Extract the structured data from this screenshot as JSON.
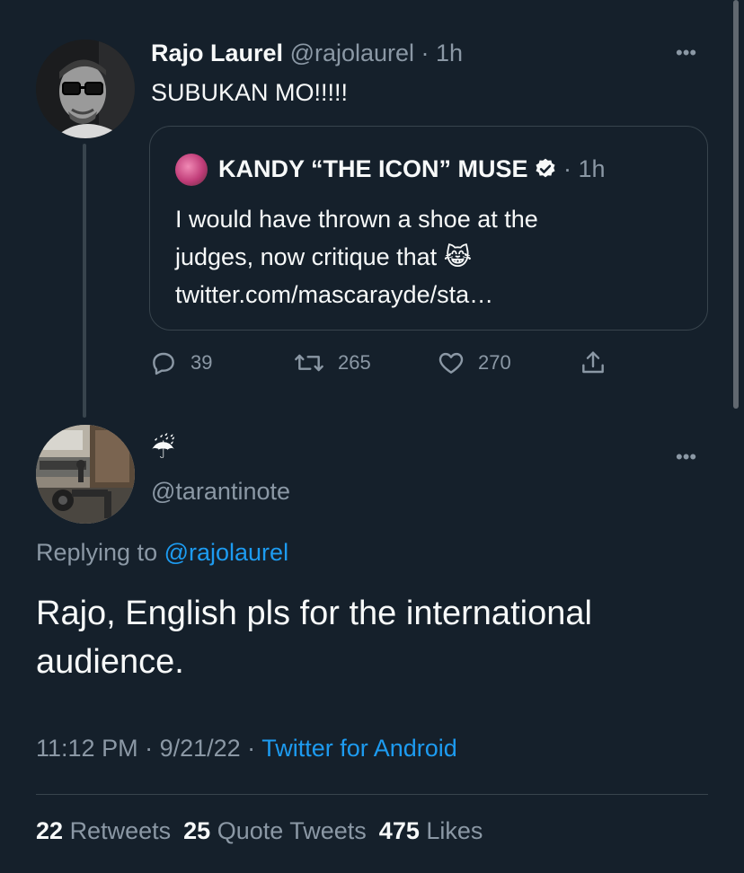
{
  "tweet_parent": {
    "display_name": "Rajo Laurel",
    "handle": "@rajolaurel",
    "separator": " · ",
    "time": "1h",
    "text": "SUBUKAN MO!!!!!",
    "more_label": "•••",
    "quoted": {
      "display_name": "KANDY “THE ICON” MUSE",
      "verified": true,
      "separator": " · ",
      "time": "1h",
      "lines": [
        "I would have thrown a shoe at the",
        "judges, now critique that 😹",
        "twitter.com/mascarayde/sta…"
      ]
    },
    "actions": {
      "replies": "39",
      "retweets": "265",
      "likes": "270"
    }
  },
  "tweet_main": {
    "display_name_emoji": "☔",
    "handle": "@tarantinote",
    "more_label": "•••",
    "replying_prefix": "Replying to ",
    "replying_to": "@rajolaurel",
    "lines": [
      "Rajo, English pls for the international",
      "audience."
    ],
    "time": "11:12 PM",
    "sep1": " · ",
    "date": "9/21/22",
    "sep2": " · ",
    "source": "Twitter for Android",
    "stats": {
      "retweets_count": "22",
      "retweets_label": "Retweets",
      "quotes_count": "25",
      "quotes_label": "Quote Tweets",
      "likes_count": "475",
      "likes_label": "Likes"
    }
  },
  "colors": {
    "background": "#15202b",
    "text": "#f7f9f9",
    "muted": "#8b98a5",
    "link": "#1d9bf0",
    "border": "#38444d"
  }
}
